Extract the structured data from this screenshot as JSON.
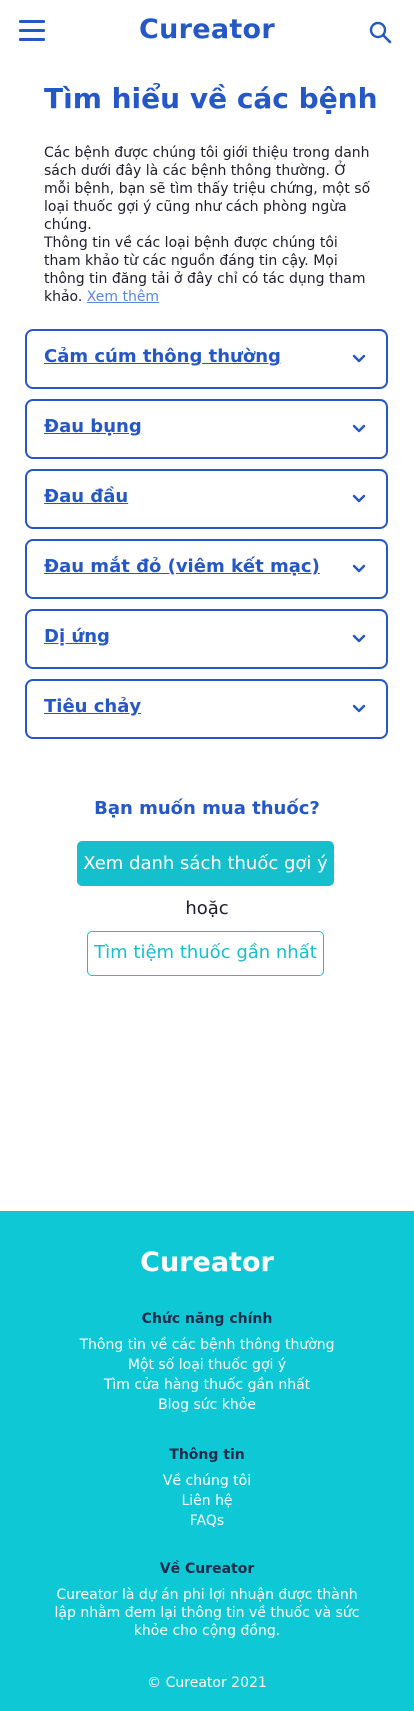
{
  "header": {
    "logo_text": "Cureator"
  },
  "page": {
    "title": "Tìm hiểu về các bệnh",
    "intro_p1": "Các bệnh được chúng tôi giới thiệu trong danh sách dưới đây là các bệnh thông thường. Ở mỗi bệnh, bạn sẽ tìm thấy triệu chứng, một số loại thuốc gợi ý cũng như cách phòng ngừa chúng.",
    "intro_p2": "Thông tin về các loại bệnh được chúng tôi tham khảo từ các nguồn đáng tin cậy. Mọi thông tin đăng tải ở đây chỉ có tác dụng tham khảo.",
    "more_link": "Xem thêm"
  },
  "diseases": [
    {
      "label": "Cảm cúm thông thường"
    },
    {
      "label": "Đau bụng"
    },
    {
      "label": "Đau đầu"
    },
    {
      "label": "Đau mắt đỏ (viêm kết mạc)"
    },
    {
      "label": "Dị ứng"
    },
    {
      "label": "Tiêu chảy"
    }
  ],
  "buy": {
    "title": "Bạn muốn mua thuốc?",
    "primary_button": "Xem danh sách thuốc gợi ý",
    "or_text": "hoặc",
    "secondary_button": "Tìm tiệm thuốc gần nhất"
  },
  "footer": {
    "logo_text": "Cureator",
    "features_heading": "Chức năng chính",
    "features": [
      "Thông tin về các bệnh thông thường",
      "Một số loại thuốc gợi ý",
      "Tìm cửa hàng thuốc gần nhất",
      "Blog sức khỏe"
    ],
    "info_heading": "Thông tin",
    "info": [
      "Về chúng tôi",
      "Liên hệ",
      "FAQs"
    ],
    "about_heading": "Về Cureator",
    "about_text": "Cureator là dự án phi lợi nhuận được thành lập nhằm đem lại thông tin về thuốc và sức khỏe cho cộng đồng.",
    "copyright": "© Cureator  2021"
  },
  "colors": {
    "brand_blue": "#2557c7",
    "accent_cyan": "#16bfcc",
    "footer_bg": "#0fc8d6"
  }
}
